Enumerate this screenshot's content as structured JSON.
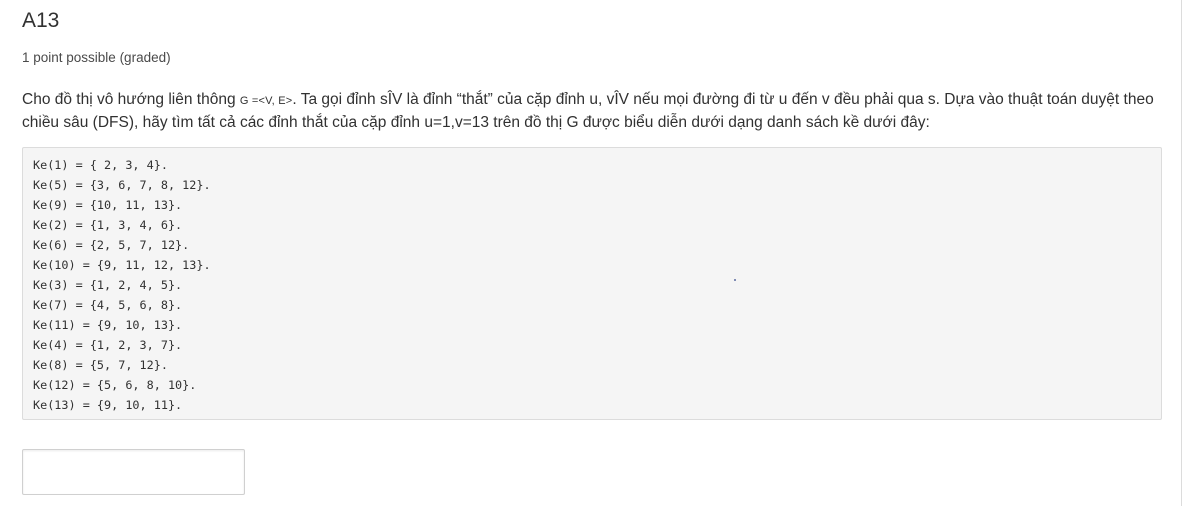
{
  "problem": {
    "title": "A13",
    "points": "1 point possible (graded)",
    "question_part1": "Cho đồ thị vô hướng liên thông ",
    "question_math": "G =<V, E>",
    "question_part2": ". Ta gọi đỉnh sÎV là đỉnh “thắt” của cặp đỉnh u, vÎV nếu mọi đường đi từ u đến v đều phải qua s. Dựa vào thuật toán duyệt theo chiều sâu (DFS), hãy tìm tất cả các đỉnh thắt của cặp đỉnh u=1,v=13 trên đồ thị G được biểu diễn dưới dạng danh sách kề dưới đây:",
    "adjacency_lines": [
      "Ke(1) = { 2, 3, 4}.",
      "Ke(5) = {3, 6, 7, 8, 12}.",
      "Ke(9) = {10, 11, 13}.",
      "Ke(2) = {1, 3, 4, 6}.",
      "Ke(6) = {2, 5, 7, 12}.",
      "Ke(10) = {9, 11, 12, 13}.",
      "Ke(3) = {1, 2, 4, 5}.",
      "Ke(7) = {4, 5, 6, 8}.",
      "Ke(11) = {9, 10, 13}.",
      "Ke(4) = {1, 2, 3, 7}.",
      "Ke(8) = {5, 7, 12}.",
      "Ke(12) = {5, 6, 8, 10}.",
      "Ke(13) = {9, 10, 11}."
    ],
    "answer": {
      "value": "",
      "placeholder": ""
    }
  }
}
